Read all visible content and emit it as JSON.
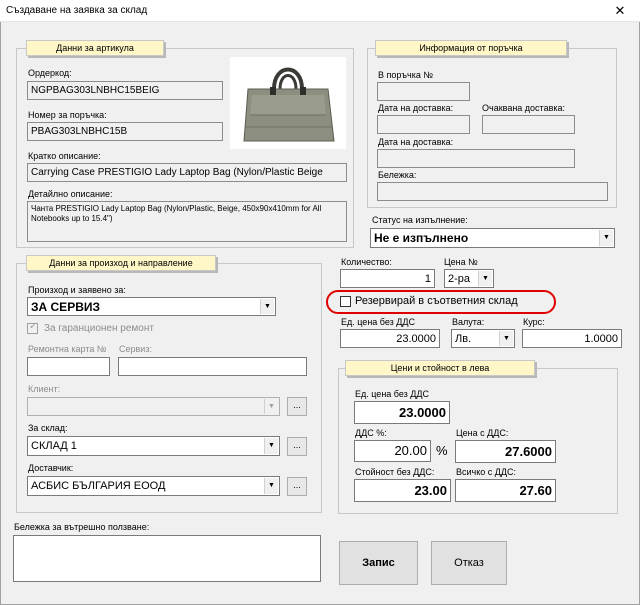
{
  "window": {
    "title": "Създаване на заявка за склад",
    "close_glyph": "✕"
  },
  "article": {
    "header": "Данни за артикула",
    "ordercode_label": "Ордеркод:",
    "ordercode_value": "NGPBAG303LNBHC15BEIG",
    "order_number_label": "Номер за поръчка:",
    "order_number_value": "PBAG303LNBHC15B",
    "short_desc_label": "Кратко описание:",
    "short_desc_value": "Carrying Case PRESTIGIO Lady Laptop Bag (Nylon/Plastic Beige",
    "detail_desc_label": "Детайлно описание:",
    "detail_desc_value": "Чанта PRESTIGIO Lady Laptop Bag (Nylon/Plastic, Beige, 450x90x410mm for All Notebooks up to 15.4\")"
  },
  "order_info": {
    "header": "Информация от поръчка",
    "in_order_label": "В поръчка №",
    "in_order_value": "",
    "delivery_date_label": "Дата на доставка:",
    "delivery_date_value": "",
    "expected_delivery_label": "Очаквана доставка:",
    "expected_delivery_value": "",
    "delivery_date2_label": "Дата на доставка:",
    "delivery_date2_value": "",
    "note_label": "Бележка:",
    "note_value": ""
  },
  "status": {
    "label": "Статус на изпълнение:",
    "value": "Не е изпълнено"
  },
  "origin": {
    "header": "Данни за произход и направление",
    "origin_label": "Произход и заявено за:",
    "origin_value": "ЗА СЕРВИЗ",
    "warranty_label": "За гаранционен ремонт",
    "repair_card_label": "Ремонтна карта №",
    "repair_card_value": "",
    "service_label": "Сервиз:",
    "service_value": "",
    "client_label": "Клиент:",
    "client_value": "",
    "warehouse_label": "За склад:",
    "warehouse_value": "СКЛАД 1",
    "supplier_label": "Доставчик:",
    "supplier_value": "АСБИС БЪЛГАРИЯ ЕООД",
    "dots_label": "..."
  },
  "quantity": {
    "qty_label": "Количество:",
    "qty_value": "1",
    "price_no_label": "Цена №",
    "price_no_value": "2-ра",
    "reserve_label": "Резервирай в съответния склад",
    "unit_price_label": "Ед. цена без ДДС",
    "unit_price_value": "23.0000",
    "currency_label": "Валута:",
    "currency_value": "Лв.",
    "rate_label": "Курс:",
    "rate_value": "1.0000"
  },
  "prices": {
    "header": "Цени и стойност в лева",
    "unit_price_label": "Ед. цена без ДДС",
    "unit_price_value": "23.0000",
    "vat_label": "ДДС %:",
    "vat_value": "20.00",
    "percent_sign": "%",
    "price_with_vat_label": "Цена с ДДС:",
    "price_with_vat_value": "27.6000",
    "total_no_vat_label": "Стойност без ДДС:",
    "total_no_vat_value": "23.00",
    "total_with_vat_label": "Всичко с ДДС:",
    "total_with_vat_value": "27.60"
  },
  "internal_note": {
    "label": "Бележка за вътрешно ползване:",
    "value": ""
  },
  "buttons": {
    "save": "Запис",
    "cancel": "Отказ"
  },
  "icons": {
    "dropdown": "chevron-down-icon",
    "close": "close-icon",
    "product": "laptop-bag-image"
  },
  "colors": {
    "header_bg": "#fff7c8",
    "highlight": "#e00000"
  }
}
